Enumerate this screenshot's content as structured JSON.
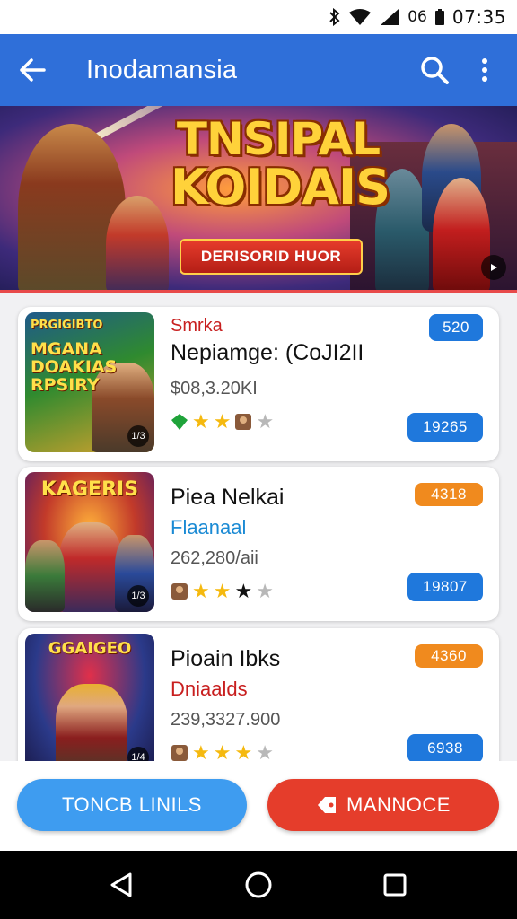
{
  "status_bar": {
    "network_label": "06",
    "time": "07:35"
  },
  "app_bar": {
    "title": "Inodamansia"
  },
  "banner": {
    "headline_line1": "TNSIPAL",
    "headline_line2": "KOIDAIS",
    "ribbon": "DERISORID HUOR"
  },
  "cards": [
    {
      "thumb_title_small": "PRGIGIBTO",
      "thumb_title_big": "MGANA DOAKIAS RPSIRY",
      "thumb_badge": "1/3",
      "sub_top": "Smrka",
      "name": "Nepiamge: (CoJI2II",
      "sub": "",
      "price": "$08,3.20KI",
      "pill_top": "520",
      "pill_bottom": "19265",
      "rating_stars": 2,
      "thumb_colors": [
        "#2f8a2f",
        "#d8a22e"
      ]
    },
    {
      "thumb_title_small": "",
      "thumb_title_big": "KAGERIS",
      "thumb_badge": "1/3",
      "sub_top": "",
      "name": "Piea Nelkai",
      "sub": "Flaanaal",
      "price": "262,280/aii",
      "pill_top": "4318",
      "pill_bottom": "19807",
      "rating_stars": 3,
      "thumb_colors": [
        "#c23a2a",
        "#6a2a9a"
      ]
    },
    {
      "thumb_title_small": "",
      "thumb_title_big": "GGAIGEO",
      "thumb_badge": "1/4",
      "sub_top": "",
      "name": "Pioain Ibks",
      "sub": "Dniaalds",
      "price": "239,3327.900",
      "pill_top": "4360",
      "pill_bottom": "6938",
      "rating_stars": 3,
      "thumb_colors": [
        "#2b3a8a",
        "#b82a3a"
      ]
    }
  ],
  "actions": {
    "primary_label": "TONCB LINILS",
    "danger_label": "MANNOCE"
  },
  "colors": {
    "app_bar": "#2f6fd9",
    "accent_blue": "#1f78dc",
    "accent_orange": "#f08a1e",
    "danger": "#e53d2b"
  }
}
